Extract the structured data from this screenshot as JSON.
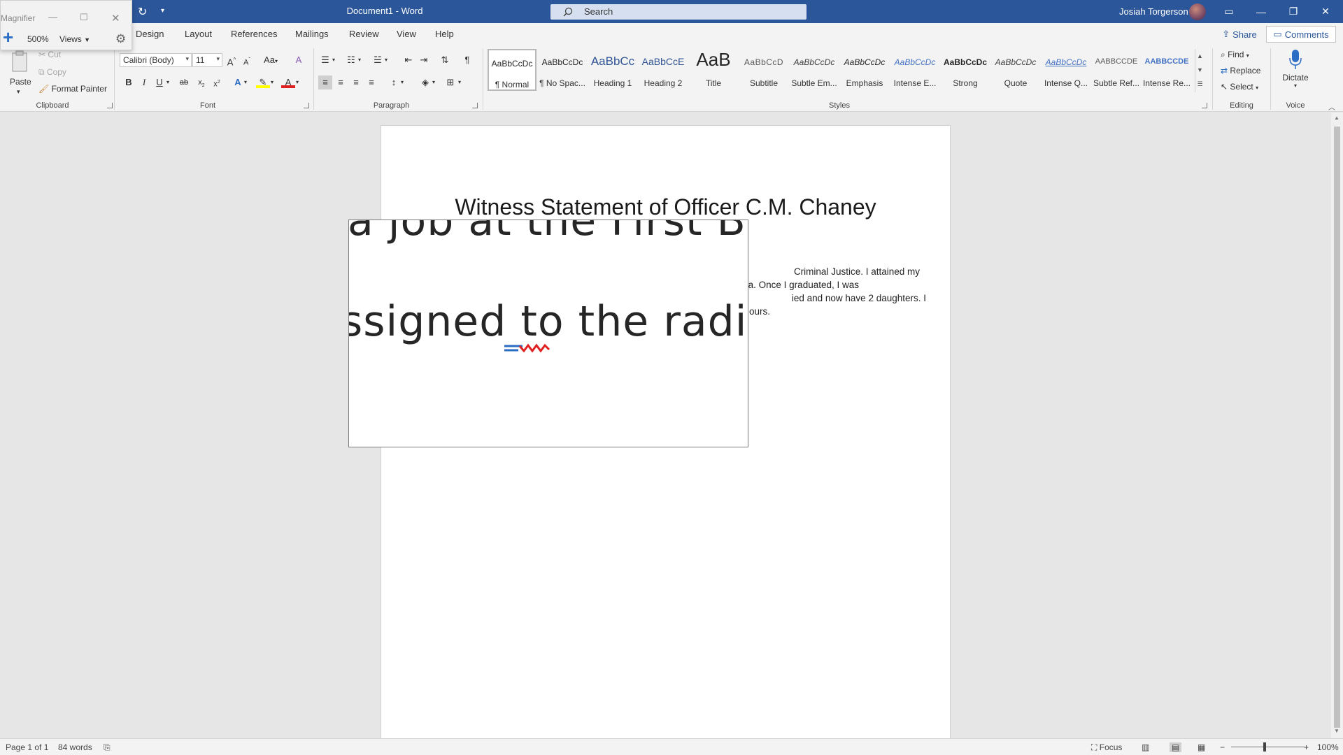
{
  "titlebar": {
    "doc_title": "Document1  -  Word",
    "search_placeholder": "Search",
    "user_name": "Josiah Torgerson",
    "undo_icon": "redo-icon",
    "minimize": "—",
    "restore": "❐",
    "close": "✕",
    "ribbon_display": "▭"
  },
  "tabs": [
    "Design",
    "Layout",
    "References",
    "Mailings",
    "Review",
    "View",
    "Help"
  ],
  "share_label": "Share",
  "comments_label": "Comments",
  "clipboard": {
    "paste": "Paste",
    "cut": "Cut",
    "copy": "Copy",
    "format_painter": "Format Painter",
    "group": "Clipboard"
  },
  "font": {
    "name": "Calibri (Body)",
    "size": "11",
    "group": "Font",
    "change_case": "Aa"
  },
  "paragraph": {
    "group": "Paragraph"
  },
  "styles": {
    "group": "Styles",
    "items": [
      {
        "sample": "AaBbCcDc",
        "name": "¶ Normal"
      },
      {
        "sample": "AaBbCcDc",
        "name": "¶ No Spac..."
      },
      {
        "sample": "AaBbCc",
        "name": "Heading 1"
      },
      {
        "sample": "AaBbCcE",
        "name": "Heading 2"
      },
      {
        "sample": "AaB",
        "name": "Title"
      },
      {
        "sample": "AaBbCcD",
        "name": "Subtitle"
      },
      {
        "sample": "AaBbCcDc",
        "name": "Subtle Em..."
      },
      {
        "sample": "AaBbCcDc",
        "name": "Emphasis"
      },
      {
        "sample": "AaBbCcDc",
        "name": "Intense E..."
      },
      {
        "sample": "AaBbCcDc",
        "name": "Strong"
      },
      {
        "sample": "AaBbCcDc",
        "name": "Quote"
      },
      {
        "sample": "AaBbCcDc",
        "name": "Intense Q..."
      },
      {
        "sample": "AABBCCDE",
        "name": "Subtle Ref..."
      },
      {
        "sample": "AABBCCDE",
        "name": "Intense Re..."
      }
    ]
  },
  "editing": {
    "find": "Find",
    "replace": "Replace",
    "select": "Select",
    "group": "Editing"
  },
  "voice": {
    "dictate": "Dictate",
    "group": "Voice"
  },
  "document": {
    "title": "Witness Statement of Officer C.M. Chaney",
    "lines": [
      "Criminal Justice. I attained my",
      "na. Once I graduated, I was",
      "ied and now have 2 daughters. I",
      "ours."
    ]
  },
  "status": {
    "page": "Page 1 of 1",
    "words": "84 words",
    "focus": "Focus",
    "zoom": "100%"
  },
  "magnifier": {
    "title": "Magnifier",
    "zoom": "500%",
    "views": "Views"
  },
  "lens": {
    "line1": "a job at the First Ba",
    "line2": "ssigned to the radio"
  },
  "colors": {
    "word_blue": "#2b579a",
    "ribbon_bg": "#f3f3f3",
    "canvas_bg": "#e6e6e6"
  }
}
